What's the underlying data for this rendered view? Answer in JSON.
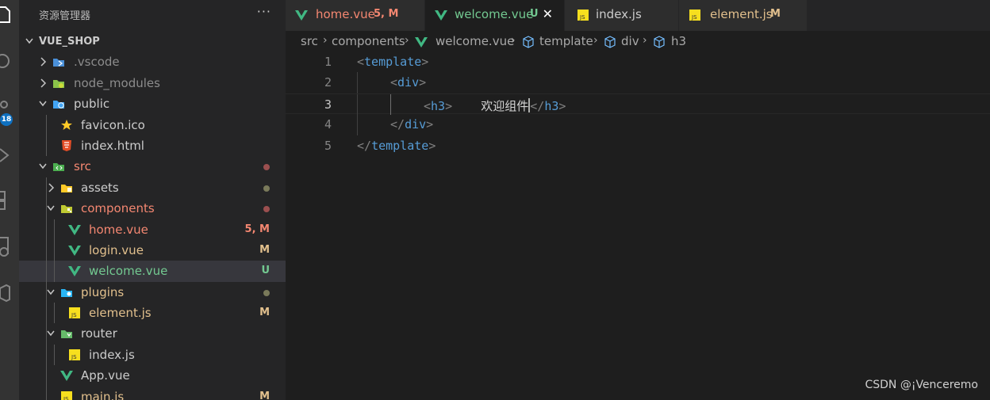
{
  "colors": {
    "modified": "#e2c08d",
    "untracked": "#73c991",
    "error_file": "#f48771",
    "vue": "#41b883",
    "js": "#cbcb41",
    "tag": "#569cd6"
  },
  "activity_bar": {
    "icons": [
      "explorer-icon",
      "search-icon",
      "source-control-icon",
      "run-debug-icon",
      "extensions-icon",
      "remote-icon",
      "package-icon"
    ],
    "scm_badge": "18"
  },
  "sidebar": {
    "title": "资源管理器",
    "more": "···",
    "root": "VUE_SHOP",
    "items": [
      {
        "label": ".vscode",
        "icon": "vscode-folder-icon",
        "badge": ""
      },
      {
        "label": "node_modules",
        "icon": "node-folder-icon",
        "badge": ""
      },
      {
        "label": "public",
        "icon": "public-folder-icon",
        "badge": ""
      },
      {
        "label": "favicon.ico",
        "icon": "star-icon",
        "badge": ""
      },
      {
        "label": "index.html",
        "icon": "html5-icon",
        "badge": ""
      },
      {
        "label": "src",
        "icon": "src-folder-icon",
        "badge": ""
      },
      {
        "label": "assets",
        "icon": "assets-folder-icon",
        "badge": ""
      },
      {
        "label": "components",
        "icon": "components-folder-icon",
        "badge": ""
      },
      {
        "label": "home.vue",
        "icon": "vue-icon",
        "badge": "5, M"
      },
      {
        "label": "login.vue",
        "icon": "vue-icon",
        "badge": "M"
      },
      {
        "label": "welcome.vue",
        "icon": "vue-icon",
        "badge": "U"
      },
      {
        "label": "plugins",
        "icon": "plugins-folder-icon",
        "badge": ""
      },
      {
        "label": "element.js",
        "icon": "js-icon",
        "badge": "M"
      },
      {
        "label": "router",
        "icon": "router-folder-icon",
        "badge": ""
      },
      {
        "label": "index.js",
        "icon": "js-icon",
        "badge": ""
      },
      {
        "label": "App.vue",
        "icon": "vue-icon",
        "badge": ""
      },
      {
        "label": "main.js",
        "icon": "js-icon",
        "badge": "M"
      }
    ]
  },
  "tabs": [
    {
      "label": "home.vue",
      "status": "5, M",
      "icon": "vue-icon"
    },
    {
      "label": "welcome.vue",
      "status": "U",
      "icon": "vue-icon",
      "close": "✕"
    },
    {
      "label": "index.js",
      "status": "",
      "icon": "js-icon"
    },
    {
      "label": "element.js",
      "status": "M",
      "icon": "js-icon"
    }
  ],
  "breadcrumb": [
    "src",
    "components",
    "welcome.vue",
    "template",
    "div",
    "h3"
  ],
  "editor": {
    "current_line": 3,
    "lines": [
      {
        "num": "1",
        "open": "<",
        "tag": "template",
        "close": ">"
      },
      {
        "num": "2",
        "open": "<",
        "tag": "div",
        "close": ">"
      },
      {
        "num": "3",
        "open": "<",
        "tag": "h3",
        "close": ">",
        "text": "    欢迎组件",
        "end_open": "</",
        "end_tag": "h3",
        "end_close": ">"
      },
      {
        "num": "4",
        "open": "</",
        "tag": "div",
        "close": ">"
      },
      {
        "num": "5",
        "open": "</",
        "tag": "template",
        "close": ">"
      }
    ]
  },
  "watermark": "CSDN @¡Venceremo"
}
